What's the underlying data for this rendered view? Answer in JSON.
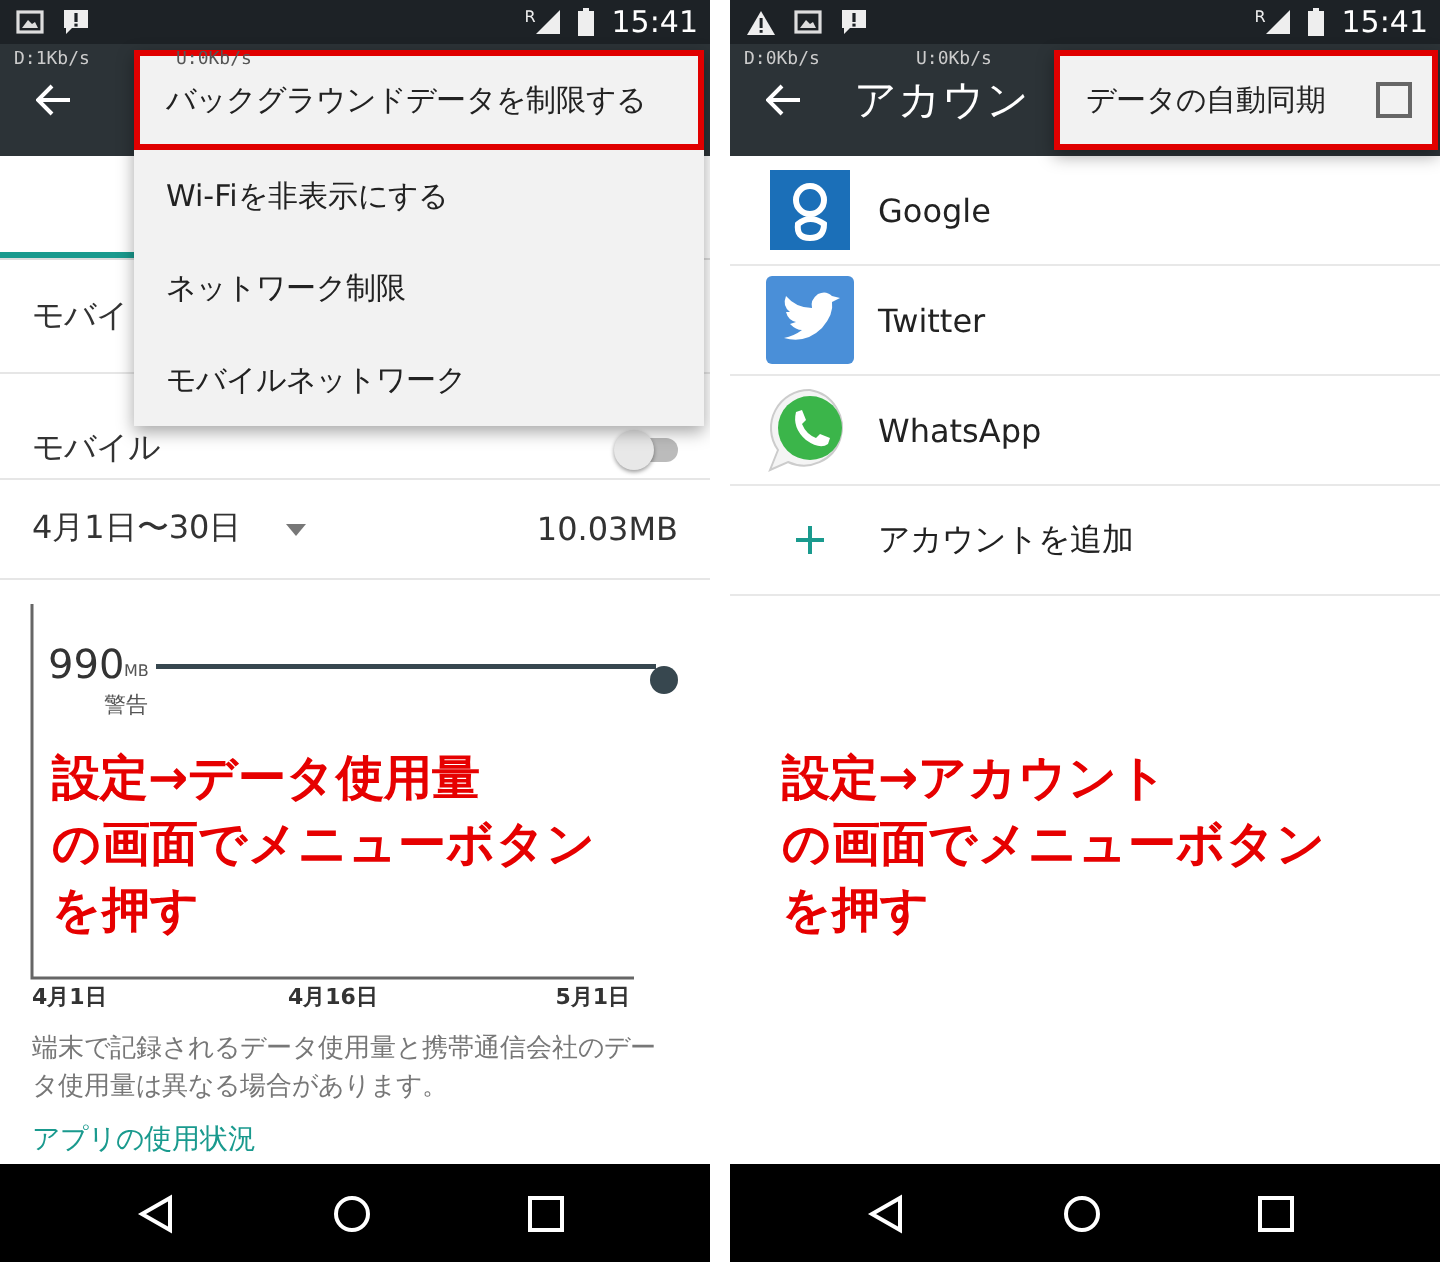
{
  "screens": [
    {
      "kind": "data_usage",
      "status_bar": {
        "notifications": [
          {
            "kind": "image"
          },
          {
            "kind": "alert"
          }
        ],
        "roaming": "R",
        "time": "15:41",
        "net_down": "D:1Kb/s",
        "net_up": "U:0Kb/s"
      },
      "menu": {
        "items": [
          {
            "label": "バックグラウンドデータを制限する",
            "highlighted": true
          },
          {
            "label": "Wi-Fiを非表示にする",
            "highlighted": false
          },
          {
            "label": "ネットワーク制限",
            "highlighted": false
          },
          {
            "label": "モバイルネットワーク",
            "highlighted": false
          }
        ]
      },
      "rows": [
        {
          "label": "モバイ"
        },
        {
          "label": "モバイル",
          "on": false
        }
      ],
      "period": {
        "label": "4月1日〜30日",
        "usage": "10.03MB"
      },
      "chart": {
        "limit": "990",
        "unit": "MB",
        "limit_label": "警告",
        "x_labels": [
          "4月1日",
          "4月16日",
          "5月1日"
        ]
      },
      "note": "端末で記録されるデータ使用量と携帯通信会社のデータ使用量は異なる場合があります。",
      "link": "アプリの使用状況",
      "annotation": [
        "設定→データ使用量",
        "の画面でメニューボタン",
        "を押す"
      ]
    },
    {
      "kind": "accounts",
      "status_bar": {
        "notifications": [
          {
            "kind": "warning"
          },
          {
            "kind": "image"
          },
          {
            "kind": "alert"
          }
        ],
        "roaming": "R",
        "time": "15:41",
        "net_down": "D:0Kb/s",
        "net_up": "U:0Kb/s"
      },
      "title": "アカウン",
      "menu": {
        "items": [
          {
            "label": "データの自動同期",
            "checked": false,
            "highlighted": true
          }
        ]
      },
      "accounts": [
        {
          "kind": "google",
          "name": "Google"
        },
        {
          "kind": "twitter",
          "name": "Twitter"
        },
        {
          "kind": "whatsapp",
          "name": "WhatsApp"
        },
        {
          "kind": "add",
          "name": "アカウントを追加"
        }
      ],
      "annotation": [
        "設定→アカウント",
        "の画面でメニューボタン",
        "を押す"
      ]
    }
  ]
}
